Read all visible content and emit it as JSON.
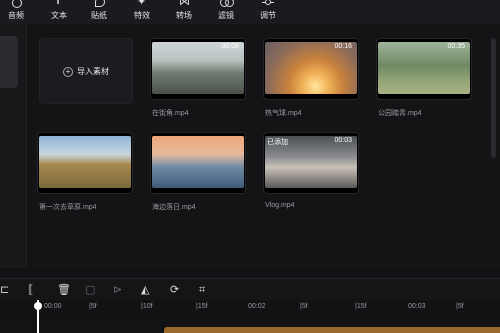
{
  "toolbar": {
    "tools": [
      {
        "label": "音频",
        "icon": "music-note-icon"
      },
      {
        "label": "文本",
        "icon": "text-icon"
      },
      {
        "label": "贴纸",
        "icon": "sticker-icon"
      },
      {
        "label": "特效",
        "icon": "effects-icon"
      },
      {
        "label": "转场",
        "icon": "transition-icon"
      },
      {
        "label": "滤镜",
        "icon": "filter-icon"
      },
      {
        "label": "调节",
        "icon": "adjust-icon"
      }
    ]
  },
  "media": {
    "import_label": "导入素材",
    "clips": [
      {
        "name": "在街角.mp4",
        "duration": "00:08",
        "badge": ""
      },
      {
        "name": "热气球.mp4",
        "duration": "00:16",
        "badge": ""
      },
      {
        "name": "公园踏青.mp4",
        "duration": "00:35",
        "badge": ""
      },
      {
        "name": "第一次去草原.mp4",
        "duration": "",
        "badge": ""
      },
      {
        "name": "海边落日.mp4",
        "duration": "",
        "badge": ""
      },
      {
        "name": "Vlog.mp4",
        "duration": "00:03",
        "badge": "已添加"
      }
    ]
  },
  "timeline": {
    "ruler": [
      "00:00",
      "|5f",
      "|10f",
      "|15f",
      "00:02",
      "|5f",
      "|15f",
      "00:03",
      "|5f",
      "|15f",
      "00:04"
    ]
  },
  "colors": {
    "accent_track": "#9a6a2c",
    "background": "#121214"
  }
}
